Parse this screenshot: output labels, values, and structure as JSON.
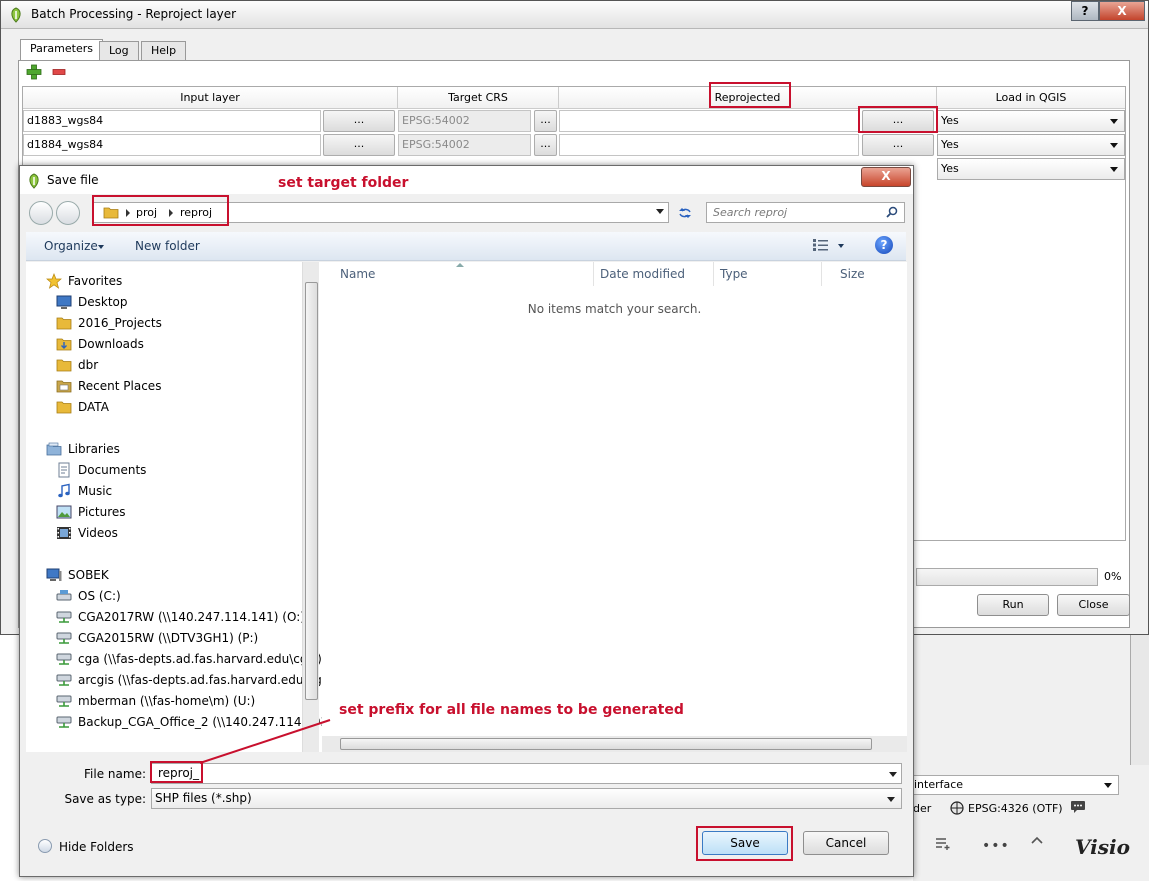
{
  "batch_window": {
    "title": "Batch Processing - Reproject layer",
    "help_button": "?",
    "close_button": "X",
    "tabs": [
      {
        "label": "Parameters"
      },
      {
        "label": "Log"
      },
      {
        "label": "Help"
      }
    ],
    "table": {
      "headers": [
        "Input layer",
        "Target CRS",
        "Reprojected",
        "Load in QGIS"
      ],
      "rows": [
        {
          "input": "d1883_wgs84",
          "crs": "EPSG:54002",
          "output": "",
          "load": "Yes"
        },
        {
          "input": "d1884_wgs84",
          "crs": "EPSG:54002",
          "output": "",
          "load": "Yes"
        },
        {
          "load": "Yes"
        }
      ],
      "browse_label": "..."
    },
    "progress": {
      "text": "0%",
      "value": 0
    },
    "run_button": "Run",
    "close_label": "Close"
  },
  "qgis": {
    "interface_combo": "interface",
    "render_label": "der",
    "crs_label": "EPSG:4326 (OTF)",
    "more_label": "•••",
    "logo_text": "Visio"
  },
  "save_dialog": {
    "title": "Save file",
    "close_button": "X",
    "breadcrumbs": [
      "proj",
      "reproj"
    ],
    "search_placeholder": "Search reproj",
    "toolbar": {
      "organize": "Organize",
      "new_folder": "New folder",
      "help": "?"
    },
    "nav": {
      "favorites": {
        "label": "Favorites",
        "items": [
          "Desktop",
          "2016_Projects",
          "Downloads",
          "dbr",
          "Recent Places",
          "DATA"
        ]
      },
      "libraries": {
        "label": "Libraries",
        "items": [
          "Documents",
          "Music",
          "Pictures",
          "Videos"
        ]
      },
      "computer": {
        "label": "SOBEK",
        "items": [
          "OS (C:)",
          "CGA2017RW (\\\\140.247.114.141) (O:)",
          "CGA2015RW (\\\\DTV3GH1) (P:)",
          "cga (\\\\fas-depts.ad.fas.harvard.edu\\cgis) (",
          "arcgis (\\\\fas-depts.ad.fas.harvard.edu\\cgis)",
          "mberman (\\\\fas-home\\m) (U:)",
          "Backup_CGA_Office_2 (\\\\140.247.114.203) ("
        ]
      }
    },
    "columns": [
      "Name",
      "Date modified",
      "Type",
      "Size"
    ],
    "empty_message": "No items match your search.",
    "file_name_label": "File name:",
    "file_name_value": "reproj_",
    "save_type_label": "Save as type:",
    "save_type_value": "SHP files (*.shp)",
    "hide_folders": "Hide Folders",
    "save_button": "Save",
    "cancel_button": "Cancel"
  },
  "annotations": {
    "target_folder": "set target folder",
    "prefix": "set prefix for all file names to be generated"
  },
  "colors": {
    "annotation": "#c8102e",
    "toolbar_text": "#1e395b",
    "save_border": "#3a7ac4"
  }
}
